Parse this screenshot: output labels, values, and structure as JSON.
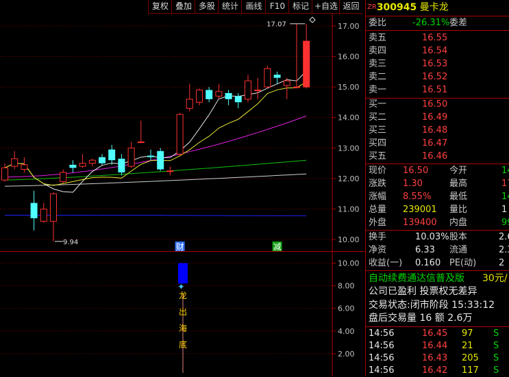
{
  "toolbar": [
    "复权",
    "叠加",
    "多股",
    "统计",
    "画线",
    "F10",
    "标记",
    "+自选",
    "返回"
  ],
  "stock": {
    "prefix": "ZR",
    "code": "300945",
    "name": "曼卡龙"
  },
  "order_ratio": {
    "label": "委比",
    "value": "-26.31%",
    "label2": "委差"
  },
  "asks": [
    {
      "label": "卖五",
      "price": "16.55"
    },
    {
      "label": "卖四",
      "price": "16.54"
    },
    {
      "label": "卖三",
      "price": "16.53"
    },
    {
      "label": "卖二",
      "price": "16.52"
    },
    {
      "label": "卖一",
      "price": "16.51"
    }
  ],
  "bids": [
    {
      "label": "买一",
      "price": "16.50"
    },
    {
      "label": "买二",
      "price": "16.49"
    },
    {
      "label": "买三",
      "price": "16.48"
    },
    {
      "label": "买四",
      "price": "16.47"
    },
    {
      "label": "买五",
      "price": "16.46"
    }
  ],
  "stats": [
    {
      "l1": "现价",
      "v1": "16.50",
      "l2": "今开",
      "v2": "14"
    },
    {
      "l1": "涨跌",
      "v1": "1.30",
      "l2": "最高",
      "v2": "17"
    },
    {
      "l1": "涨幅",
      "v1": "8.55%",
      "l2": "最低",
      "v2": "14"
    },
    {
      "l1": "总量",
      "v1": "239001",
      "l2": "量比",
      "v2": "1"
    },
    {
      "l1": "外盘",
      "v1": "139400",
      "l2": "内盘",
      "v2": "99"
    }
  ],
  "fundamentals": [
    {
      "l1": "换手",
      "v1": "10.03%",
      "l2": "股本",
      "v2": "2.6"
    },
    {
      "l1": "净资",
      "v1": "6.33",
      "l2": "流通",
      "v2": "2.3"
    },
    {
      "l1": "收益(一)",
      "v1": "0.160",
      "l2": "PE(动)",
      "v2": "2"
    }
  ],
  "ad": {
    "text": "自动续费通达信普及版",
    "price": "30元/"
  },
  "notice": "公司已盈利 投票权无差异",
  "trade_status": {
    "label": "交易状态:",
    "value": "闭市阶段",
    "time": "15:33:12"
  },
  "after_hours": {
    "label": "盘后交易量",
    "vol": "16",
    "amount_label": "额",
    "amount": "2.6万"
  },
  "ticks": [
    {
      "time": "14:56",
      "price": "16.45",
      "vol": "97",
      "side": "S"
    },
    {
      "time": "14:56",
      "price": "16.44",
      "vol": "21",
      "side": "S"
    },
    {
      "time": "14:56",
      "price": "16.43",
      "vol": "205",
      "side": "S"
    },
    {
      "time": "14:56",
      "price": "16.42",
      "vol": "117",
      "side": "S"
    }
  ],
  "chart_data": [
    {
      "type": "candlestick",
      "y_ticks": [
        "17.00",
        "16.00",
        "15.00",
        "14.00",
        "13.00",
        "12.00",
        "11.00",
        "10.00"
      ],
      "ylim": [
        9.6,
        17.4
      ],
      "candles": [
        {
          "o": 11.95,
          "c": 12.35,
          "h": 12.5,
          "l": 11.9
        },
        {
          "o": 12.4,
          "c": 12.65,
          "h": 12.9,
          "l": 12.3
        },
        {
          "o": 12.3,
          "c": 12.45,
          "h": 12.7,
          "l": 12.2
        },
        {
          "o": 11.2,
          "c": 10.7,
          "h": 11.6,
          "l": 10.3
        },
        {
          "o": 10.6,
          "c": 11.0,
          "h": 11.2,
          "l": 10.55
        },
        {
          "o": 10.6,
          "c": 11.5,
          "h": 11.55,
          "l": 9.94
        },
        {
          "o": 11.9,
          "c": 12.2,
          "h": 12.3,
          "l": 11.85
        },
        {
          "o": 12.45,
          "c": 12.35,
          "h": 12.6,
          "l": 12.2
        },
        {
          "o": 12.4,
          "c": 12.5,
          "h": 12.8,
          "l": 12.35
        },
        {
          "o": 12.5,
          "c": 12.6,
          "h": 12.65,
          "l": 12.4
        },
        {
          "o": 12.7,
          "c": 12.5,
          "h": 12.8,
          "l": 12.45
        },
        {
          "o": 12.95,
          "c": 12.6,
          "h": 13.1,
          "l": 12.45
        },
        {
          "o": 12.65,
          "c": 12.2,
          "h": 12.8,
          "l": 12.1
        },
        {
          "o": 12.4,
          "c": 13.0,
          "h": 13.2,
          "l": 12.35
        },
        {
          "o": 13.2,
          "c": 13.2,
          "h": 13.9,
          "l": 13.2
        },
        {
          "o": 12.75,
          "c": 12.7,
          "h": 12.95,
          "l": 12.6
        },
        {
          "o": 12.9,
          "c": 12.3,
          "h": 13.0,
          "l": 12.25
        },
        {
          "o": 12.25,
          "c": 12.25,
          "h": 12.4,
          "l": 12.1
        },
        {
          "o": 12.8,
          "c": 14.1,
          "h": 14.15,
          "l": 12.75
        },
        {
          "o": 14.3,
          "c": 14.6,
          "h": 15.1,
          "l": 14.2
        },
        {
          "o": 14.5,
          "c": 14.9,
          "h": 14.95,
          "l": 14.4
        },
        {
          "o": 14.9,
          "c": 14.6,
          "h": 15.0,
          "l": 14.5
        },
        {
          "o": 14.7,
          "c": 14.85,
          "h": 15.1,
          "l": 14.6
        },
        {
          "o": 14.8,
          "c": 14.6,
          "h": 14.9,
          "l": 14.4
        },
        {
          "o": 14.7,
          "c": 14.5,
          "h": 14.8,
          "l": 14.3
        },
        {
          "o": 14.6,
          "c": 15.2,
          "h": 15.4,
          "l": 14.5
        },
        {
          "o": 14.9,
          "c": 14.9,
          "h": 15.3,
          "l": 14.6
        },
        {
          "o": 15.0,
          "c": 15.6,
          "h": 15.7,
          "l": 14.95
        },
        {
          "o": 15.4,
          "c": 15.3,
          "h": 15.5,
          "l": 15.1
        },
        {
          "o": 15.05,
          "c": 15.2,
          "h": 15.3,
          "l": 14.6
        },
        {
          "o": 15.0,
          "c": 15.0,
          "h": 17.07,
          "l": 14.95
        },
        {
          "o": 15.0,
          "c": 16.5,
          "h": 17.07,
          "l": 14.95
        }
      ],
      "annotations": [
        {
          "text": "17.07",
          "price": 17.07
        },
        {
          "text": "9.94",
          "price": 9.94
        }
      ],
      "markers": [
        {
          "text": "财"
        },
        {
          "text": "减"
        }
      ]
    },
    {
      "type": "bar",
      "y_ticks": [
        "10.00",
        "8.00",
        "6.00",
        "4.00",
        "2.00"
      ],
      "ylim": [
        0,
        11
      ],
      "signal_text": [
        "龙",
        "出",
        "海",
        "底"
      ]
    }
  ]
}
